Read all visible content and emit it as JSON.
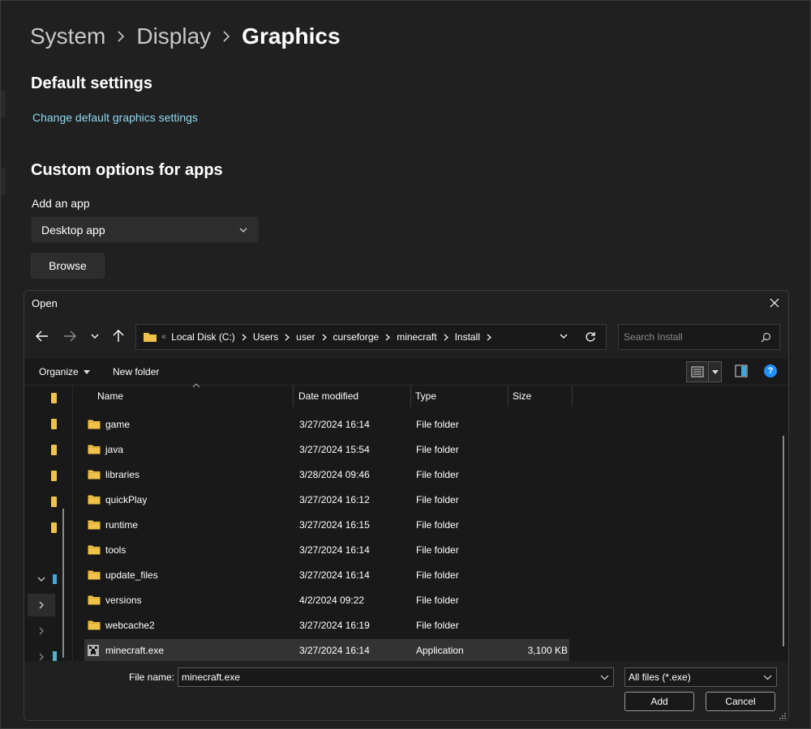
{
  "settings": {
    "breadcrumb": [
      "System",
      "Display",
      "Graphics"
    ],
    "default_settings_title": "Default settings",
    "default_link": "Change default graphics settings",
    "custom_title": "Custom options for apps",
    "add_app_label": "Add an app",
    "app_type_selected": "Desktop app",
    "browse_label": "Browse"
  },
  "dialog": {
    "title": "Open",
    "address": [
      "Local Disk (C:)",
      "Users",
      "user",
      "curseforge",
      "minecraft",
      "Install"
    ],
    "search_placeholder": "Search Install",
    "organize_label": "Organize",
    "new_folder_label": "New folder",
    "help_glyph": "?",
    "columns": {
      "name": "Name",
      "date": "Date modified",
      "type": "Type",
      "size": "Size"
    },
    "files": [
      {
        "name": "game",
        "date": "3/27/2024 16:14",
        "type": "File folder",
        "size": "",
        "kind": "folder"
      },
      {
        "name": "java",
        "date": "3/27/2024 15:54",
        "type": "File folder",
        "size": "",
        "kind": "folder"
      },
      {
        "name": "libraries",
        "date": "3/28/2024 09:46",
        "type": "File folder",
        "size": "",
        "kind": "folder"
      },
      {
        "name": "quickPlay",
        "date": "3/27/2024 16:12",
        "type": "File folder",
        "size": "",
        "kind": "folder"
      },
      {
        "name": "runtime",
        "date": "3/27/2024 16:15",
        "type": "File folder",
        "size": "",
        "kind": "folder"
      },
      {
        "name": "tools",
        "date": "3/27/2024 16:14",
        "type": "File folder",
        "size": "",
        "kind": "folder"
      },
      {
        "name": "update_files",
        "date": "3/27/2024 16:14",
        "type": "File folder",
        "size": "",
        "kind": "folder"
      },
      {
        "name": "versions",
        "date": "4/2/2024 09:22",
        "type": "File folder",
        "size": "",
        "kind": "folder"
      },
      {
        "name": "webcache2",
        "date": "3/27/2024 16:19",
        "type": "File folder",
        "size": "",
        "kind": "folder"
      },
      {
        "name": "minecraft.exe",
        "date": "3/27/2024 16:14",
        "type": "Application",
        "size": "3,100 KB",
        "kind": "exe"
      }
    ],
    "file_name_label": "File name:",
    "file_name_value": "minecraft.exe",
    "file_type_filter": "All files (*.exe)",
    "add_label": "Add",
    "cancel_label": "Cancel"
  },
  "icons": {
    "folder": "folder-icon",
    "exe": "minecraft-app-icon",
    "back": "arrow-left-icon",
    "forward": "arrow-right-icon",
    "up": "arrow-up-icon",
    "refresh": "refresh-icon",
    "search": "search-icon",
    "close": "close-icon"
  },
  "colors": {
    "accent_link": "#8fd8f0",
    "folder": "#f0c24a",
    "help": "#1e90ff",
    "selected_row": "#333333"
  }
}
